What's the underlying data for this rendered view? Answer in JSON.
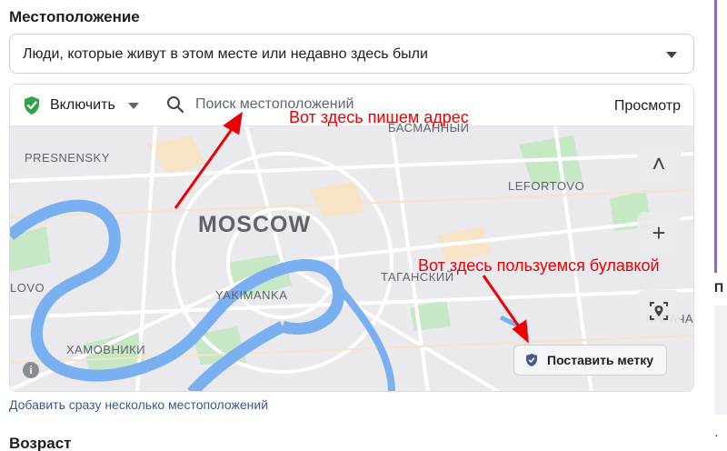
{
  "location_section": {
    "title": "Местоположение",
    "audience_dropdown": "Люди, которые живут в этом месте или недавно здесь были"
  },
  "map_toolbar": {
    "include_label": "Включить",
    "search_placeholder": "Поиск местоположений",
    "preview_label": "Просмотр"
  },
  "map": {
    "city": "MOSCOW",
    "districts": {
      "presnensky": "PRESNENSKY",
      "basmanny": "БАСМАННЫЙ",
      "lefortovo": "LEFORTOVO",
      "yakimanka": "YAKIMANKA",
      "tagansky": "ТАГАНСКИЙ",
      "khamovniki": "ХАМОВНИКИ",
      "lovo": "LOVO",
      "karacha": "КАРАЧА"
    },
    "controls": {
      "collapse": "˄",
      "zoom_in": "+"
    },
    "drop_pin_label": "Поставить метку",
    "info_icon": "i"
  },
  "annotations": {
    "address_note": "Вот здесь пишем адрес",
    "pin_note": "Вот здесь пользуемся булавкой"
  },
  "add_multiple_link": "Добавить сразу несколько местоположений",
  "age_section": {
    "title": "Возраст"
  },
  "right_edge": {
    "char1": "П",
    "char2": "·"
  },
  "colors": {
    "annotation_red": "#ee0000",
    "river_blue": "#7bb0f0",
    "park_green": "#c6e8c4",
    "link_blue": "#385898",
    "shield_green": "#31a24c"
  }
}
